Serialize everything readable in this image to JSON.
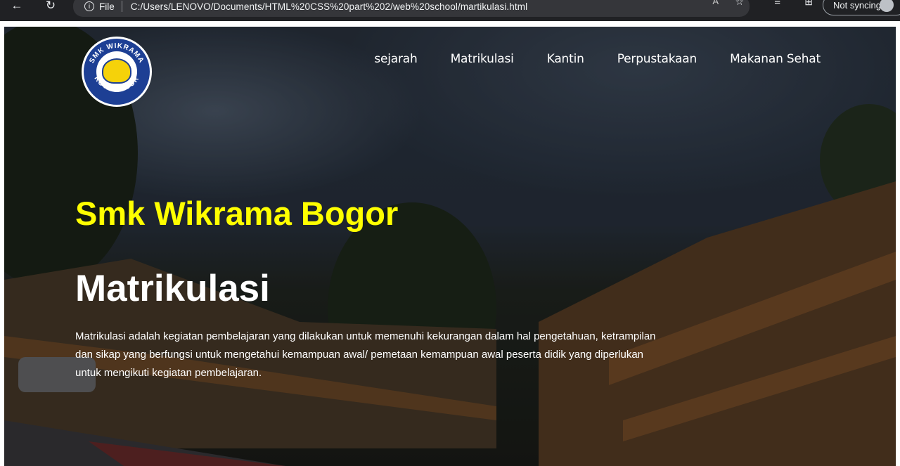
{
  "browser": {
    "info_label": "File",
    "url": "C:/Users/LENOVO/Documents/HTML%20CSS%20part%202/web%20school/martikulasi.html",
    "read_aloud_label": "A",
    "profile_label": "Not syncing"
  },
  "nav": {
    "items": [
      "sejarah",
      "Matrikulasi",
      "Kantin",
      "Perpustakaan",
      "Makanan Sehat"
    ]
  },
  "hero": {
    "brand": "Smk Wikrama Bogor",
    "title": "Matrikulasi",
    "description": "Matrikulasi adalah kegiatan pembelajaran yang dilakukan untuk memenuhi kekurangan dalam hal pengetahuan, ketrampilan dan sikap yang berfungsi untuk mengetahui kemampuan awal/ pemetaan kemampuan awal peserta didik yang diperlukan untuk mengikuti kegiatan pembelajaran."
  },
  "logo": {
    "text_top": "SMK WIKRAMA",
    "text_bottom": "KOTA BOGOR"
  },
  "colors": {
    "brand": "#ffff00",
    "logo_blue": "#1d3f94",
    "logo_yellow": "#f5d20a"
  }
}
